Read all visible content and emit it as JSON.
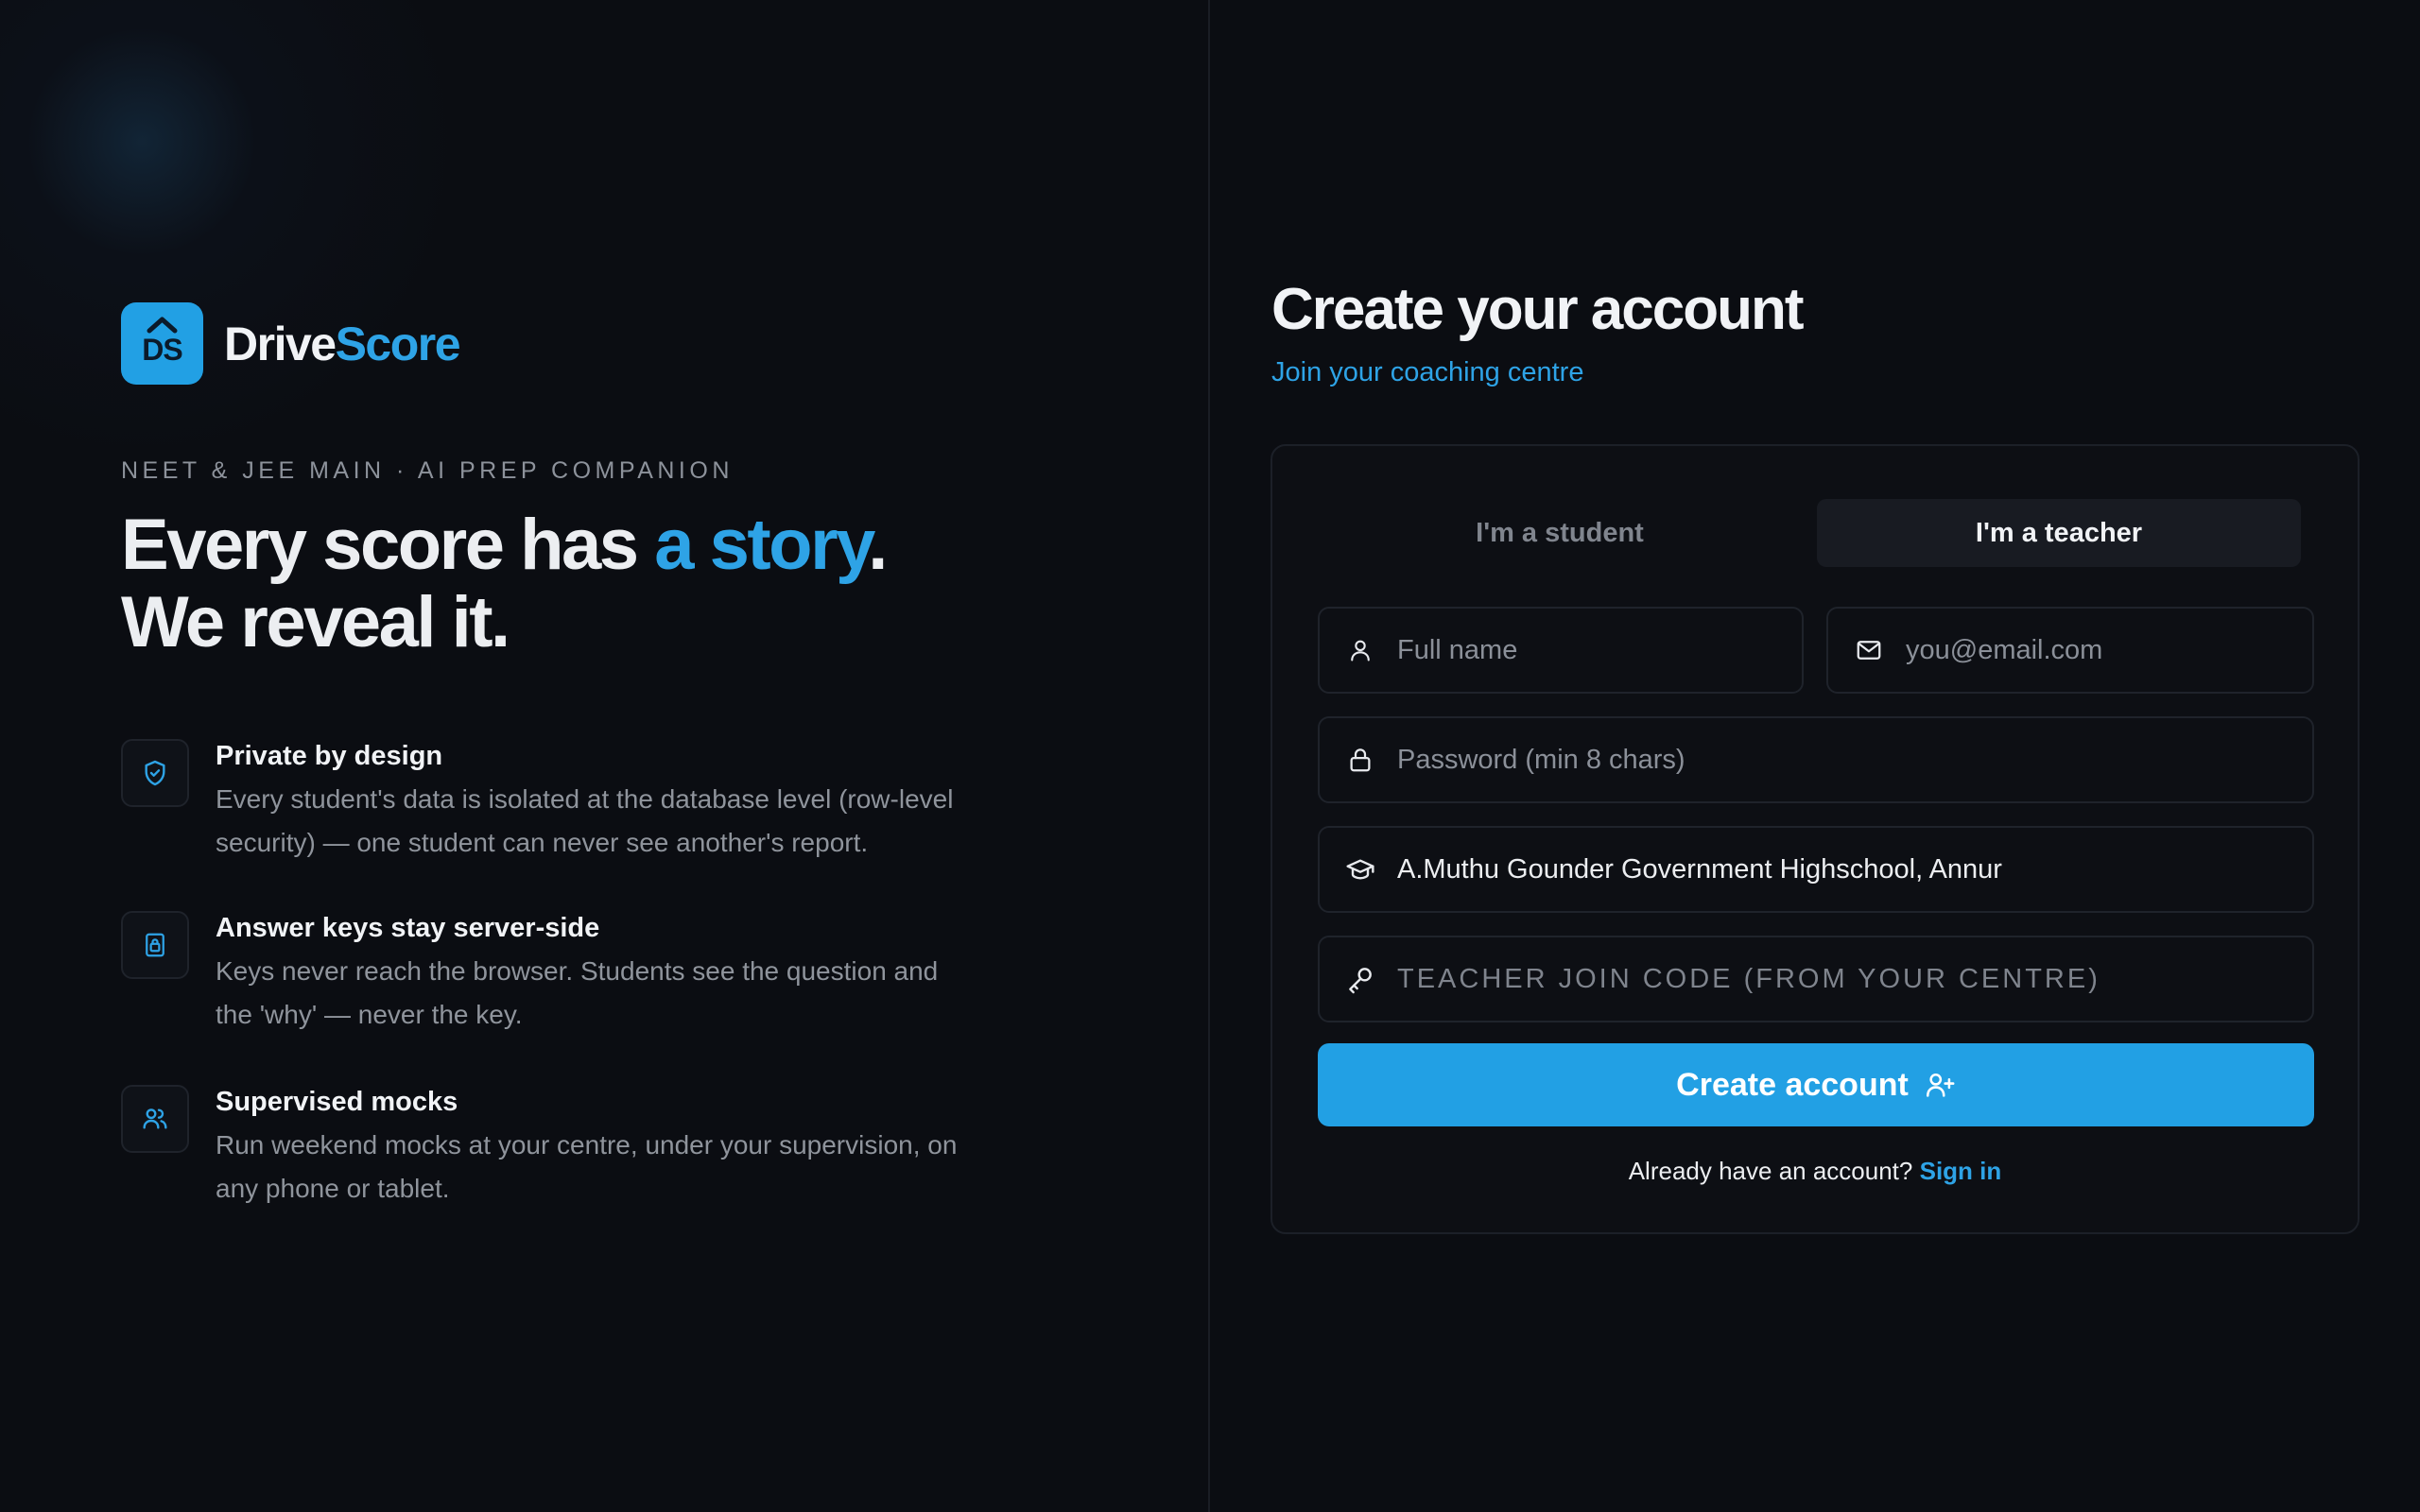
{
  "brand": {
    "logo_text": "DS",
    "name_part1": "Drive",
    "name_part2": "Score"
  },
  "hero": {
    "kicker": "NEET & JEE MAIN · AI PREP COMPANION",
    "headline_part1": "Every score has ",
    "headline_accent": "a story",
    "headline_period": ".",
    "headline_line2": "We reveal it."
  },
  "features": [
    {
      "icon": "shield-check-icon",
      "title": "Private by design",
      "description": "Every student's data is isolated at the database level (row-level security) — one student can never see another's report."
    },
    {
      "icon": "lock-icon",
      "title": "Answer keys stay server-side",
      "description": "Keys never reach the browser. Students see the question and the 'why' — never the key."
    },
    {
      "icon": "users-icon",
      "title": "Supervised mocks",
      "description": "Run weekend mocks at your centre, under your supervision, on any phone or tablet."
    }
  ],
  "form": {
    "title": "Create your account",
    "subtitle": "Join your coaching centre",
    "roles": [
      {
        "label": "I'm a student",
        "active": false
      },
      {
        "label": "I'm a teacher",
        "active": true
      }
    ],
    "fields": {
      "full_name": {
        "placeholder": "Full name",
        "value": ""
      },
      "email": {
        "placeholder": "you@email.com",
        "value": ""
      },
      "password": {
        "placeholder": "Password (min 8 chars)",
        "value": ""
      },
      "school": {
        "placeholder": "",
        "value": "A.Muthu Gounder Government Highschool, Annur"
      },
      "join_code": {
        "placeholder": "TEACHER JOIN CODE (FROM YOUR CENTRE)",
        "value": ""
      }
    },
    "submit_label": "Create account",
    "signin_prompt": "Already have an account?",
    "signin_link": "Sign in"
  },
  "colors": {
    "background": "#0b0d12",
    "accent": "#22a0e4",
    "accent_text": "#2ea3e6",
    "muted_text": "#8f949c"
  }
}
